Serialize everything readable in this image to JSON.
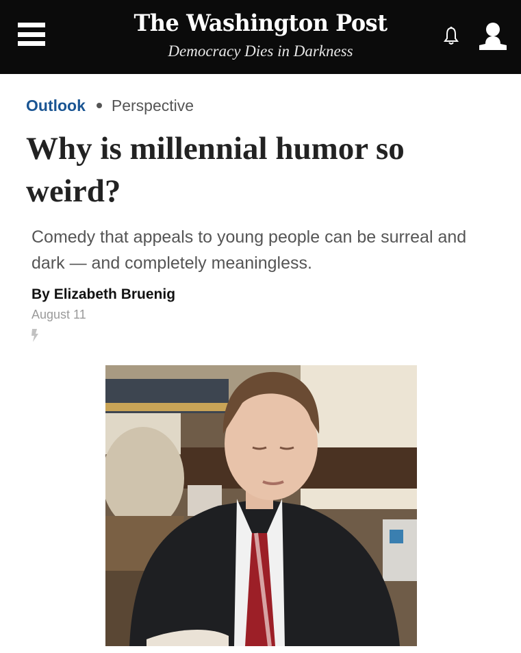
{
  "header": {
    "logo": "The Washington Post",
    "tagline": "Democracy Dies in Darkness",
    "menu_icon": "hamburger-menu-icon",
    "notifications_icon": "bell-icon",
    "account_icon": "user-icon"
  },
  "article": {
    "section": "Outlook",
    "label": "Perspective",
    "headline": "Why is millennial humor so weird?",
    "dek": "Comedy that appeals to young people can be surreal and dark — and completely meaningless.",
    "byline_prefix": "By ",
    "author": "Elizabeth Bruenig",
    "date": "August 11",
    "amp_icon": "lightning-bolt-icon"
  },
  "colors": {
    "topbar": "#0b0b0b",
    "section_link": "#1a5593",
    "headline": "#222222",
    "dek": "#555555",
    "date": "#9a9a9a"
  }
}
